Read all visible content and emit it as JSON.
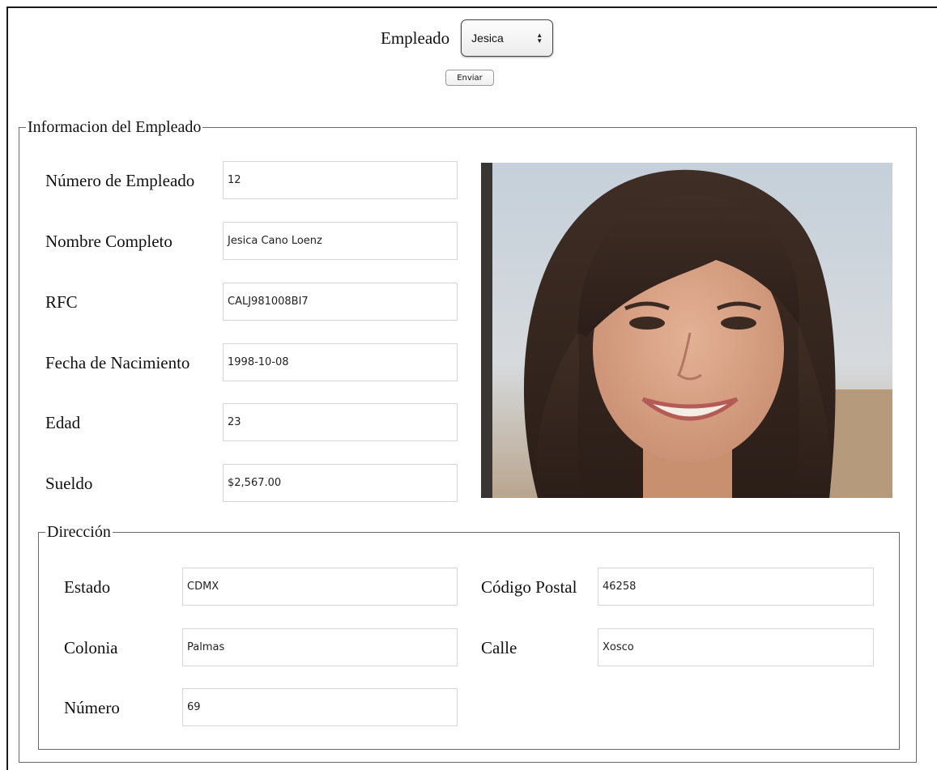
{
  "header": {
    "employee_label": "Empleado",
    "selected_employee": "Jesica",
    "submit_label": "Enviar"
  },
  "info": {
    "legend": "Informacion del Empleado",
    "fields": [
      {
        "label": "Número de Empleado",
        "value": "12"
      },
      {
        "label": "Nombre Completo",
        "value": "Jesica Cano Loenz"
      },
      {
        "label": "RFC",
        "value": "CALJ981008BI7"
      },
      {
        "label": "Fecha de Nacimiento",
        "value": "1998-10-08"
      },
      {
        "label": "Edad",
        "value": "23"
      },
      {
        "label": "Sueldo",
        "value": "$2,567.00"
      }
    ]
  },
  "address": {
    "legend": "Dirección",
    "estado": {
      "label": "Estado",
      "value": "CDMX"
    },
    "codigo_postal": {
      "label": "Código Postal",
      "value": "46258"
    },
    "colonia": {
      "label": "Colonia",
      "value": "Palmas"
    },
    "calle": {
      "label": "Calle",
      "value": "Xosco"
    },
    "numero": {
      "label": "Número",
      "value": "69"
    }
  },
  "photo": {
    "icon": "employee-photo",
    "colors": {
      "sky": "#c9d3dc",
      "hair": "#3a2a22",
      "skin": "#d9a488"
    }
  }
}
